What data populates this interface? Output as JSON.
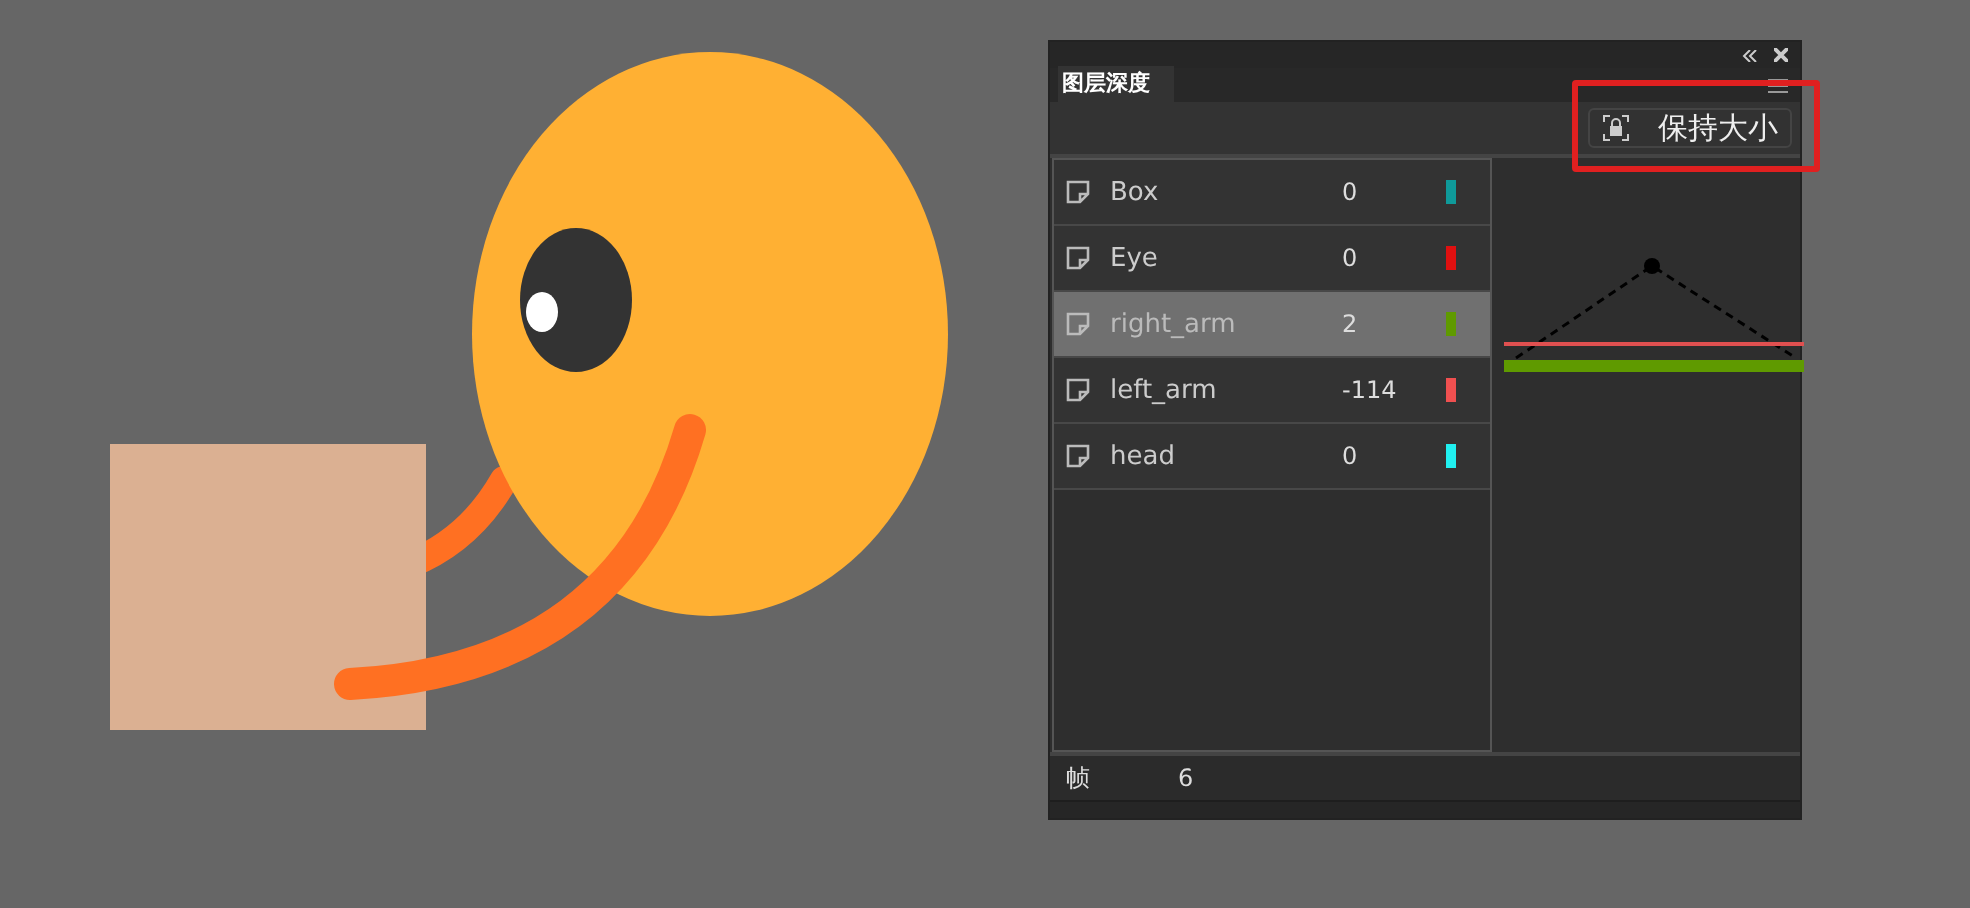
{
  "panel": {
    "tabs": [
      {
        "label": "图层深度",
        "selected": true
      }
    ],
    "keep_size_button": {
      "label": "保持大小",
      "highlighted": true
    },
    "layers": [
      {
        "name": "Box",
        "value": "0",
        "color": "#0f9a9a",
        "selected": false
      },
      {
        "name": "Eye",
        "value": "0",
        "color": "#e01010",
        "selected": false
      },
      {
        "name": "right_arm",
        "value": "2",
        "color": "#5f9a00",
        "selected": true
      },
      {
        "name": "left_arm",
        "value": "-114",
        "color": "#f05050",
        "selected": false
      },
      {
        "name": "head",
        "value": "0",
        "color": "#20f0f0",
        "selected": false
      }
    ],
    "footer": {
      "label": "帧",
      "value": "6"
    }
  }
}
